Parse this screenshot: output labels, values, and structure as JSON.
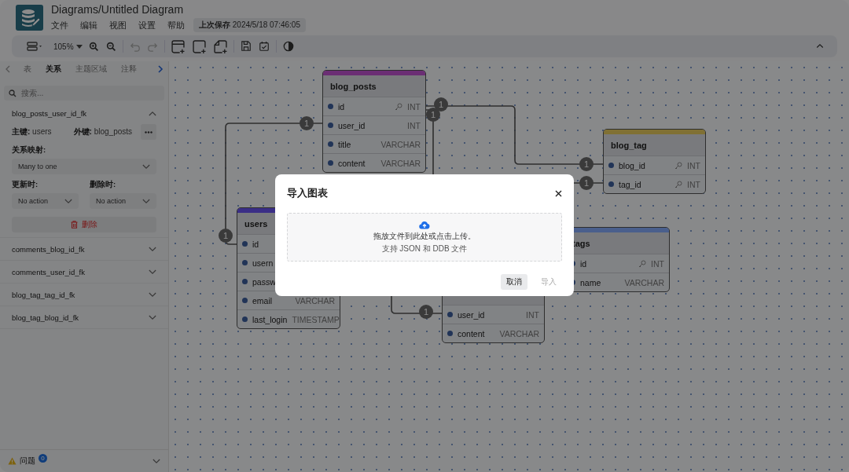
{
  "app": {
    "title": "Diagrams/Untitled Diagram",
    "menu": [
      "文件",
      "编辑",
      "视图",
      "设置",
      "帮助"
    ],
    "last_saved": "**上次保存** 2024/5/18 07:46:05"
  },
  "toolbar": {
    "zoom": "105%"
  },
  "sidebar": {
    "tabs": [
      {
        "label": "表",
        "selected": false
      },
      {
        "label": "关系",
        "selected": true
      },
      {
        "label": "主题区域",
        "selected": false
      },
      {
        "label": "注释",
        "selected": false
      }
    ],
    "search": {
      "placeholder": "搜索..."
    },
    "relationships": [
      {
        "name": "blog_posts_user_id_fk",
        "expanded": true,
        "primary": "**主键:** users",
        "foreign": "**外键:** blog_posts",
        "mapping_label": "关系映射:",
        "mapping": "Many to one",
        "update_label": "更新时:",
        "on_update": "No action",
        "delete_label": "删除时:",
        "on_delete": "No action",
        "delete_button": "删除"
      },
      {
        "name": "comments_blog_id_fk",
        "expanded": false
      },
      {
        "name": "comments_user_id_fk",
        "expanded": false
      },
      {
        "name": "blog_tag_tag_id_fk",
        "expanded": false
      },
      {
        "name": "blog_tag_blog_id_fk",
        "expanded": false
      }
    ],
    "issues": {
      "label": "问题",
      "count": "0"
    }
  },
  "canvas": {
    "tables": [
      {
        "name": "blog_posts",
        "color": "#6b2f74",
        "fields": [
          {
            "name": "id",
            "type": "INT",
            "primary_key": true
          },
          {
            "name": "user_id",
            "type": "INT",
            "primary_key": false
          },
          {
            "name": "title",
            "type": "VARCHAR",
            "primary_key": false
          },
          {
            "name": "content",
            "type": "VARCHAR",
            "primary_key": false
          }
        ]
      },
      {
        "name": "users",
        "color": "#3b2f86",
        "fields": [
          {
            "name": "id",
            "primary_key": false
          },
          {
            "name": "usern",
            "primary_key": false
          },
          {
            "name": "passw",
            "primary_key": false
          },
          {
            "name": "email",
            "type": "VARCHAR",
            "primary_key": false
          },
          {
            "name": "last_login",
            "type": "TIMESTAMP",
            "primary_key": false
          }
        ]
      },
      {
        "name": "blog_tag",
        "color": "#807135",
        "fields": [
          {
            "name": "blog_id",
            "type": "INT",
            "primary_key": true
          },
          {
            "name": "tag_id",
            "type": "INT",
            "primary_key": true
          }
        ]
      },
      {
        "name": "tags",
        "color": "#4a5f96",
        "fields": [
          {
            "name": "id",
            "type": "INT",
            "primary_key": true
          },
          {
            "name": "name",
            "type": "VARCHAR",
            "primary_key": false
          }
        ]
      },
      {
        "fields": [
          {
            "name": "user_id",
            "type": "INT",
            "primary_key": false
          },
          {
            "name": "content",
            "type": "VARCHAR",
            "primary_key": false
          }
        ]
      }
    ],
    "connectors": [
      {
        "labels": [
          "1",
          "1"
        ]
      },
      {
        "labels": [
          "1",
          "1"
        ]
      },
      {
        "labels": [
          "1"
        ]
      },
      {
        "labels": [
          "1"
        ]
      },
      {
        "labels": [
          "1"
        ]
      }
    ]
  },
  "dialog": {
    "title": "导入图表",
    "dropzone": {
      "text": "拖放文件到此处或点击上传。",
      "hint": "支持 JSON 和 DDB 文件"
    },
    "buttons": [
      {
        "label": "取消",
        "disabled": false
      },
      {
        "label": "导入",
        "disabled": true
      }
    ]
  }
}
